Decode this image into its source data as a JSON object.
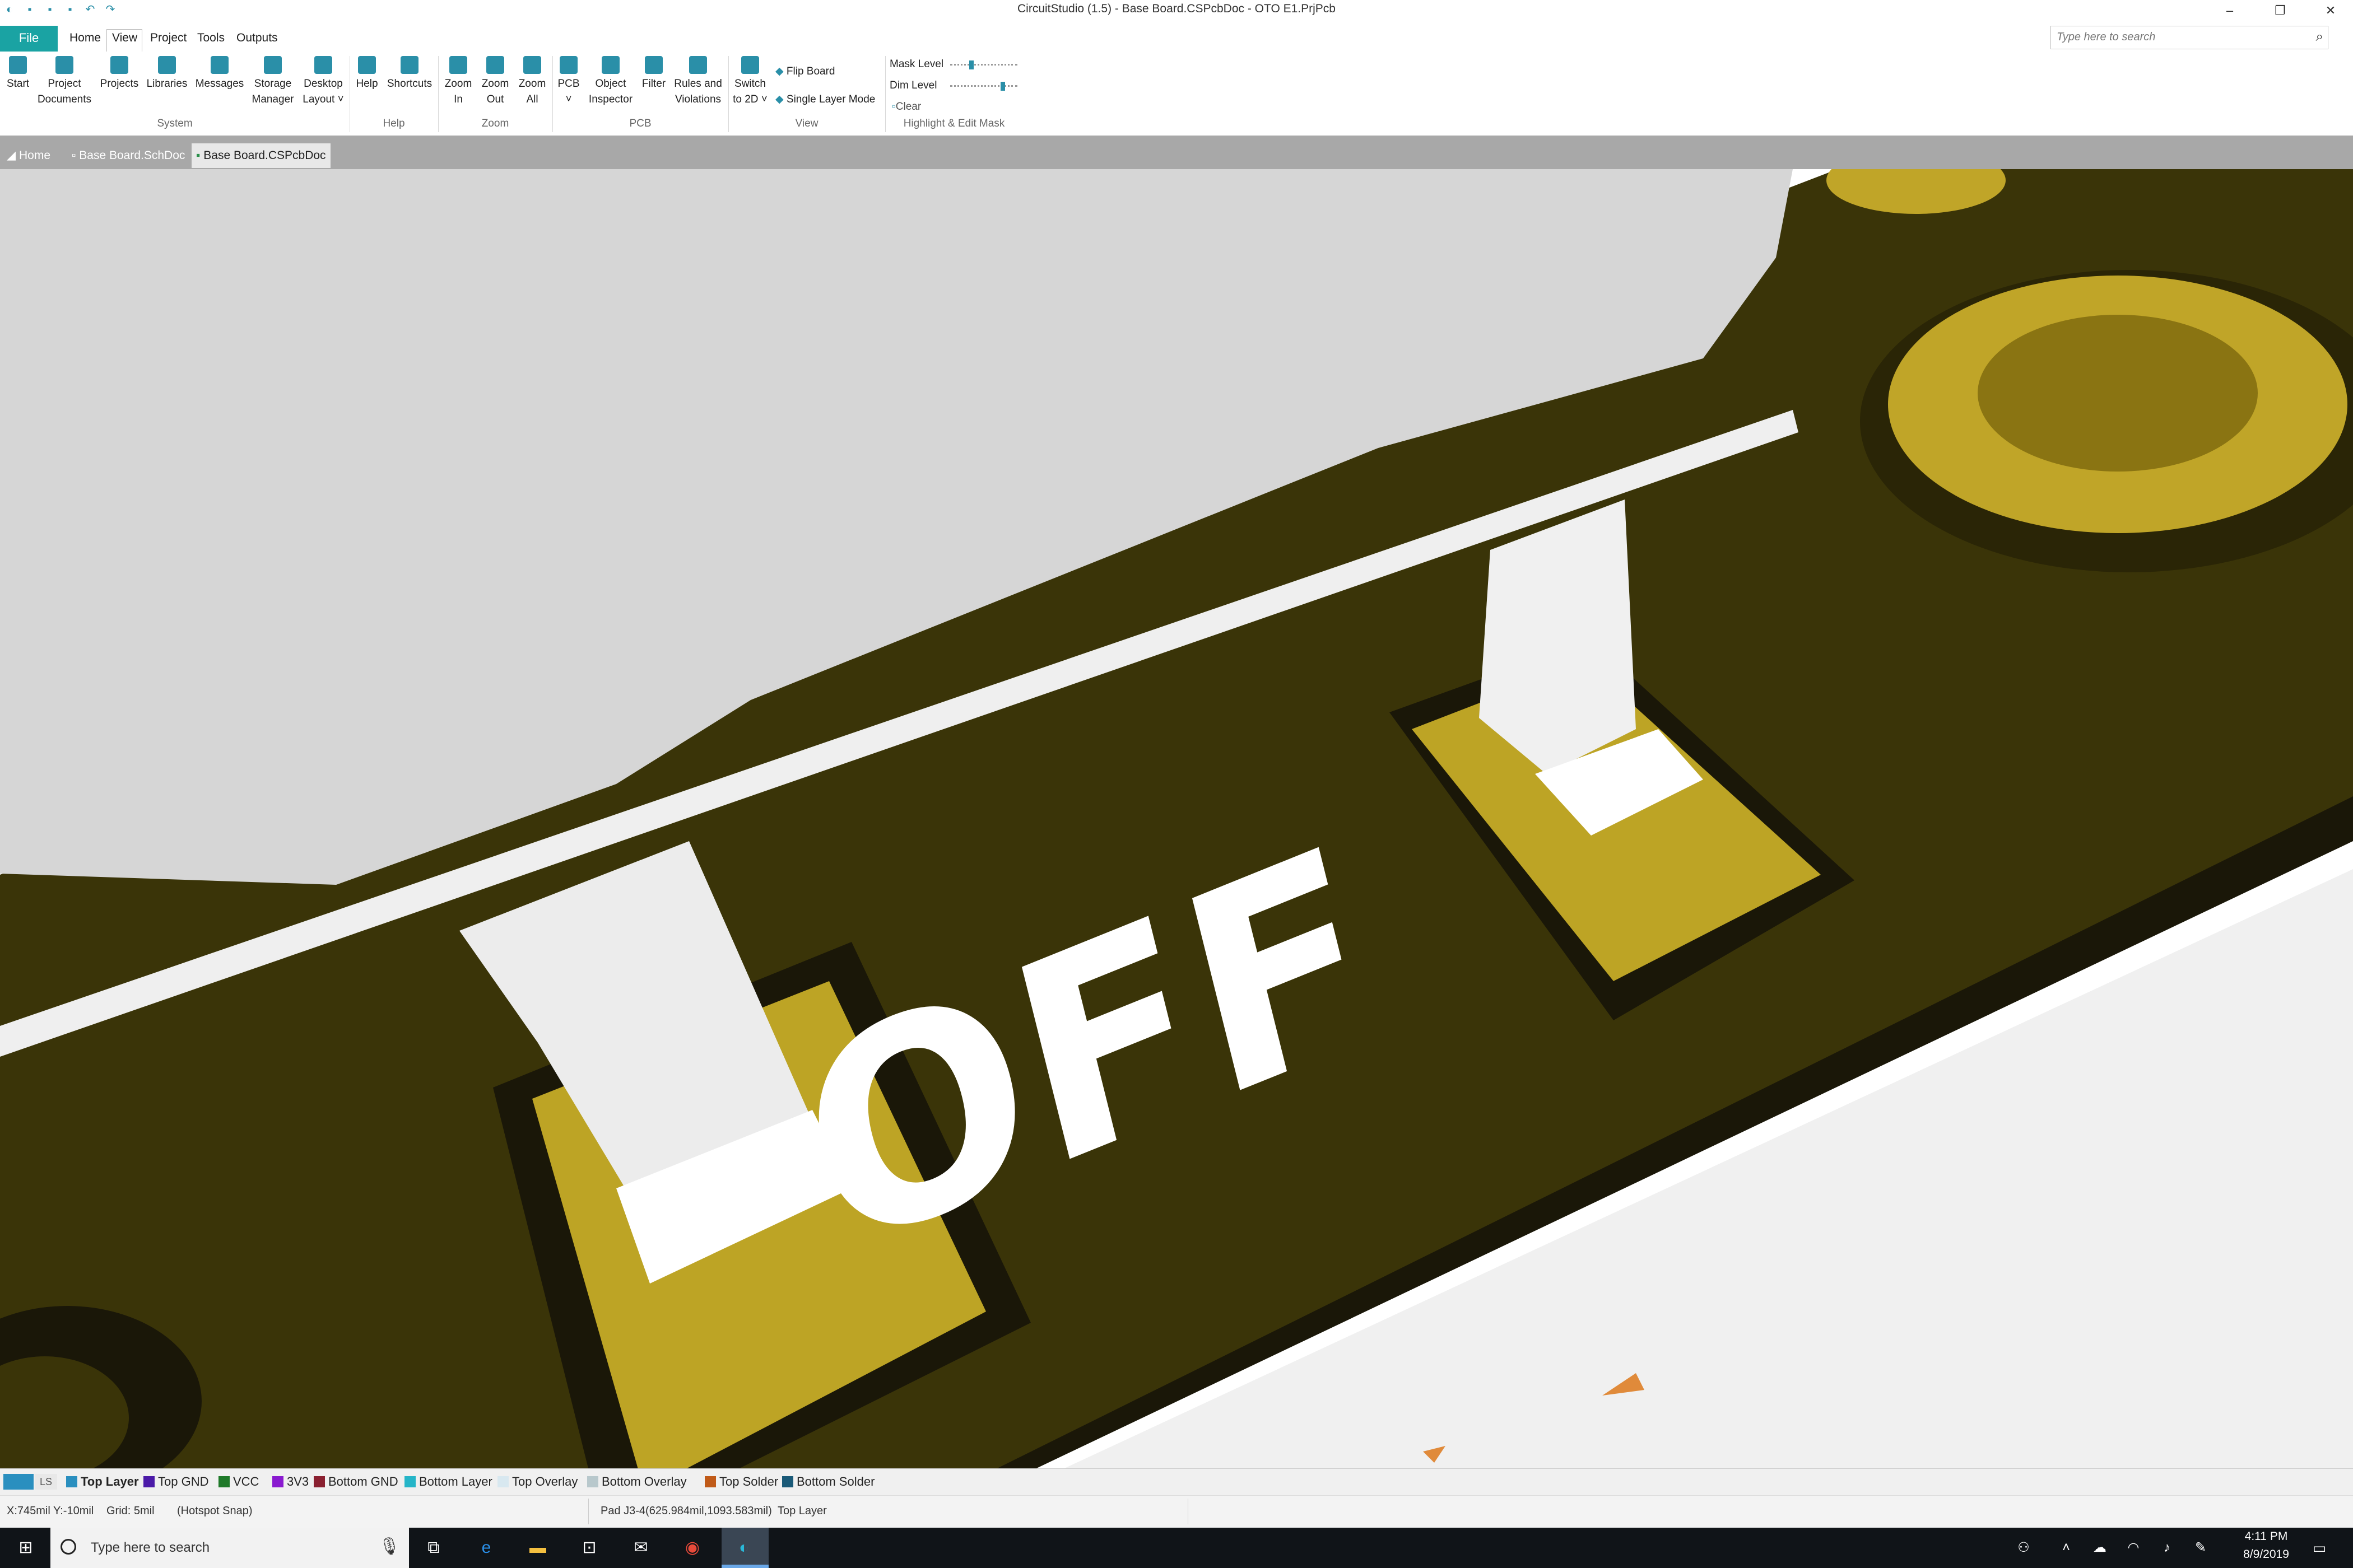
{
  "window": {
    "title": "CircuitStudio (1.5) - Base Board.CSPcbDoc - OTO E1.PrjPcb",
    "controls": [
      "–",
      "❐",
      "✕"
    ]
  },
  "menu": {
    "file": "File",
    "items": [
      "Home",
      "View",
      "Project",
      "Tools",
      "Outputs"
    ],
    "search_placeholder": "Type here to search"
  },
  "ribbon": {
    "buttons": [
      {
        "line1": "Start",
        "line2": ""
      },
      {
        "line1": "Project",
        "line2": "Documents"
      },
      {
        "line1": "Projects",
        "line2": ""
      },
      {
        "line1": "Libraries",
        "line2": ""
      },
      {
        "line1": "Messages",
        "line2": ""
      },
      {
        "line1": "Storage",
        "line2": "Manager"
      },
      {
        "line1": "Desktop",
        "line2": "Layout ˅"
      },
      {
        "line1": "Help",
        "line2": ""
      },
      {
        "line1": "Shortcuts",
        "line2": ""
      },
      {
        "line1": "Zoom",
        "line2": "In"
      },
      {
        "line1": "Zoom",
        "line2": "Out"
      },
      {
        "line1": "Zoom",
        "line2": "All"
      },
      {
        "line1": "PCB",
        "line2": "˅"
      },
      {
        "line1": "Object",
        "line2": "Inspector"
      },
      {
        "line1": "Filter",
        "line2": ""
      },
      {
        "line1": "Rules and",
        "line2": "Violations"
      },
      {
        "line1": "Switch",
        "line2": "to 2D ˅"
      }
    ],
    "view_options": [
      "Flip Board",
      "Single Layer Mode"
    ],
    "mask_labels": [
      "Mask Level",
      "Dim Level"
    ],
    "mask_levels": [
      0.3,
      0.8
    ],
    "clear": "Clear",
    "groups": [
      "System",
      "Help",
      "Zoom",
      "PCB",
      "View",
      "Highlight & Edit Mask"
    ]
  },
  "tabs": [
    "Home",
    "Base Board.SchDoc",
    "Base Board.CSPcbDoc"
  ],
  "viewport": {
    "silk_text": "OFF"
  },
  "layers": {
    "ls": "LS",
    "items": [
      {
        "label": "Top Layer",
        "color": "#2a8fbf"
      },
      {
        "label": "Top GND",
        "color": "#4b1aa8"
      },
      {
        "label": "VCC",
        "color": "#1f7a2a"
      },
      {
        "label": "3V3",
        "color": "#8a1ad0"
      },
      {
        "label": "Bottom GND",
        "color": "#8a2030"
      },
      {
        "label": "Bottom Layer",
        "color": "#25b5c8"
      },
      {
        "label": "Top Overlay",
        "color": "#d8e8f0"
      },
      {
        "label": "Bottom Overlay",
        "color": "#b8c8cc"
      },
      {
        "label": "Top Solder",
        "color": "#c05a18"
      },
      {
        "label": "Bottom Solder",
        "color": "#1a5a78"
      }
    ]
  },
  "status": {
    "coords": "X:745mil Y:-10mil",
    "grid": "Grid: 5mil",
    "snap": "(Hotspot Snap)",
    "pad": "Pad J3-4(625.984mil,1093.583mil)",
    "layer": "Top Layer"
  },
  "taskbar": {
    "search": "Type here to search",
    "time": "4:11 PM",
    "date": "8/9/2019"
  }
}
